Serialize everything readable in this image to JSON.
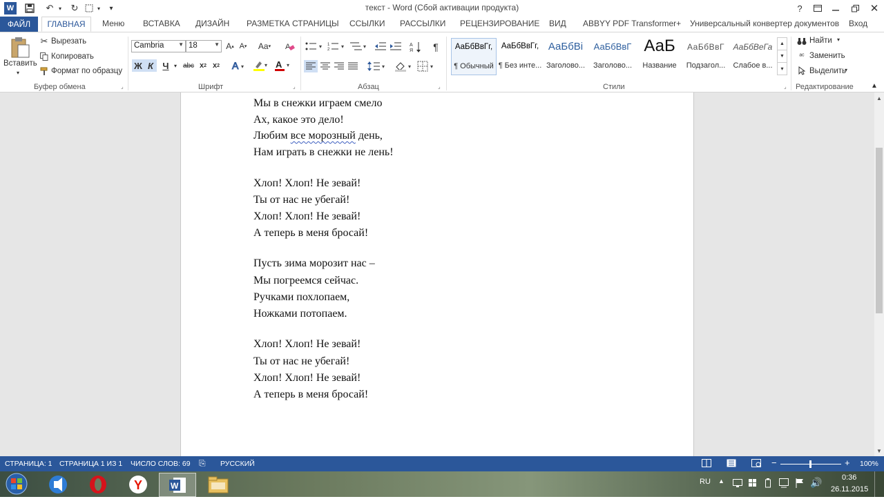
{
  "titlebar": {
    "title": "текст - Word (Сбой активации продукта)",
    "help": "?",
    "word_logo": "W"
  },
  "tabs": [
    "ФАЙЛ",
    "ГЛАВНАЯ",
    "Меню",
    "ВСТАВКА",
    "ДИЗАЙН",
    "РАЗМЕТКА СТРАНИЦЫ",
    "ССЫЛКИ",
    "РАССЫЛКИ",
    "РЕЦЕНЗИРОВАНИЕ",
    "ВИД",
    "ABBYY PDF Transformer+",
    "Универсальный конвертер документов",
    "Вход"
  ],
  "clipboard": {
    "paste": "Вставить",
    "cut": "Вырезать",
    "copy": "Копировать",
    "format_painter": "Формат по образцу",
    "label": "Буфер обмена"
  },
  "font": {
    "name": "Cambria",
    "size": "18",
    "bold": "Ж",
    "italic": "К",
    "underline": "Ч",
    "strike": "abc",
    "label": "Шрифт"
  },
  "paragraph": {
    "label": "Абзац"
  },
  "styles": {
    "label": "Стили",
    "items": [
      {
        "preview": "АаБбВвГг,",
        "name": "¶ Обычный"
      },
      {
        "preview": "АаБбВвГг,",
        "name": "¶ Без инте..."
      },
      {
        "preview": "АаБбВі",
        "name": "Заголово..."
      },
      {
        "preview": "АаБбВвГ",
        "name": "Заголово..."
      },
      {
        "preview": "АаБ",
        "name": "Название"
      },
      {
        "preview": "АаБбВвГ",
        "name": "Подзагол..."
      },
      {
        "preview": "АаБбВеГа",
        "name": "Слабое в..."
      }
    ]
  },
  "editing": {
    "find": "Найти",
    "replace": "Заменить",
    "select": "Выделить",
    "label": "Редактирование"
  },
  "document": {
    "lines": [
      {
        "text": "Мы в снежки играем смело"
      },
      {
        "text": "Ах, какое это дело!"
      },
      {
        "pre": "Любим ",
        "err": "все  морозный",
        "post": " день,"
      },
      {
        "text": "Нам играть в снежки не лень!"
      },
      {
        "text": "Хлоп! Хлоп! Не зевай!"
      },
      {
        "text": "Ты от нас не убегай!"
      },
      {
        "text": "Хлоп! Хлоп! Не зевай!"
      },
      {
        "text": "А теперь в меня бросай!"
      },
      {
        "text": "Пусть зима морозит нас –"
      },
      {
        "text": "Мы погреемся сейчас."
      },
      {
        "text": "Ручками похлопаем,"
      },
      {
        "text": "Ножками потопаем."
      },
      {
        "text": "Хлоп! Хлоп! Не зевай!"
      },
      {
        "text": "Ты от нас не убегай!"
      },
      {
        "text": "Хлоп! Хлоп! Не зевай!"
      },
      {
        "text": "А теперь в меня бросай!"
      }
    ]
  },
  "status": {
    "page": "СТРАНИЦА: 1",
    "pages": "СТРАНИЦА 1 ИЗ 1",
    "words": "ЧИСЛО СЛОВ: 69",
    "lang": "РУССКИЙ",
    "zoom": "100%"
  },
  "tray": {
    "lang": "RU",
    "time": "0:36",
    "date": "26.11.2015"
  },
  "colors": {
    "accent": "#2b579a"
  }
}
